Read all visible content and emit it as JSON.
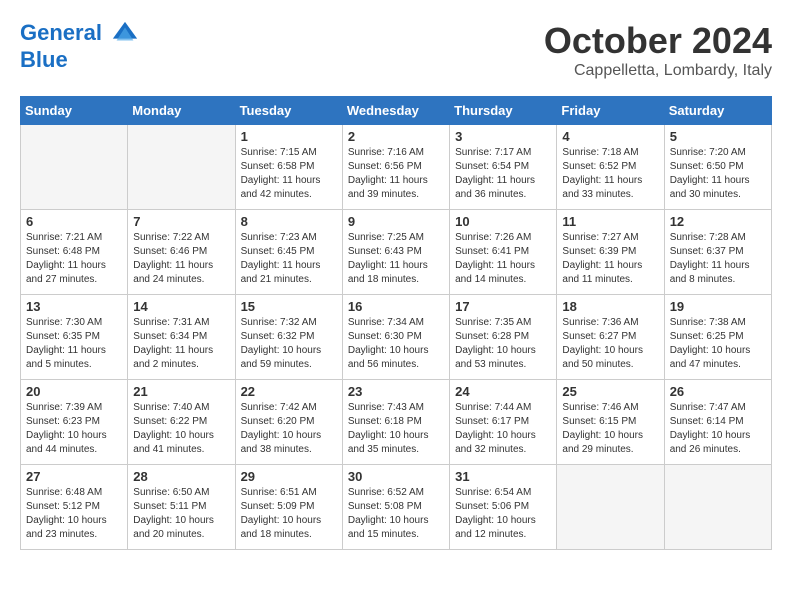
{
  "logo": {
    "line1": "General",
    "line2": "Blue"
  },
  "header": {
    "month": "October 2024",
    "location": "Cappelletta, Lombardy, Italy"
  },
  "weekdays": [
    "Sunday",
    "Monday",
    "Tuesday",
    "Wednesday",
    "Thursday",
    "Friday",
    "Saturday"
  ],
  "weeks": [
    [
      {
        "day": "",
        "info": "",
        "empty": true
      },
      {
        "day": "",
        "info": "",
        "empty": true
      },
      {
        "day": "1",
        "info": "Sunrise: 7:15 AM\nSunset: 6:58 PM\nDaylight: 11 hours\nand 42 minutes."
      },
      {
        "day": "2",
        "info": "Sunrise: 7:16 AM\nSunset: 6:56 PM\nDaylight: 11 hours\nand 39 minutes."
      },
      {
        "day": "3",
        "info": "Sunrise: 7:17 AM\nSunset: 6:54 PM\nDaylight: 11 hours\nand 36 minutes."
      },
      {
        "day": "4",
        "info": "Sunrise: 7:18 AM\nSunset: 6:52 PM\nDaylight: 11 hours\nand 33 minutes."
      },
      {
        "day": "5",
        "info": "Sunrise: 7:20 AM\nSunset: 6:50 PM\nDaylight: 11 hours\nand 30 minutes."
      }
    ],
    [
      {
        "day": "6",
        "info": "Sunrise: 7:21 AM\nSunset: 6:48 PM\nDaylight: 11 hours\nand 27 minutes."
      },
      {
        "day": "7",
        "info": "Sunrise: 7:22 AM\nSunset: 6:46 PM\nDaylight: 11 hours\nand 24 minutes."
      },
      {
        "day": "8",
        "info": "Sunrise: 7:23 AM\nSunset: 6:45 PM\nDaylight: 11 hours\nand 21 minutes."
      },
      {
        "day": "9",
        "info": "Sunrise: 7:25 AM\nSunset: 6:43 PM\nDaylight: 11 hours\nand 18 minutes."
      },
      {
        "day": "10",
        "info": "Sunrise: 7:26 AM\nSunset: 6:41 PM\nDaylight: 11 hours\nand 14 minutes."
      },
      {
        "day": "11",
        "info": "Sunrise: 7:27 AM\nSunset: 6:39 PM\nDaylight: 11 hours\nand 11 minutes."
      },
      {
        "day": "12",
        "info": "Sunrise: 7:28 AM\nSunset: 6:37 PM\nDaylight: 11 hours\nand 8 minutes."
      }
    ],
    [
      {
        "day": "13",
        "info": "Sunrise: 7:30 AM\nSunset: 6:35 PM\nDaylight: 11 hours\nand 5 minutes."
      },
      {
        "day": "14",
        "info": "Sunrise: 7:31 AM\nSunset: 6:34 PM\nDaylight: 11 hours\nand 2 minutes."
      },
      {
        "day": "15",
        "info": "Sunrise: 7:32 AM\nSunset: 6:32 PM\nDaylight: 10 hours\nand 59 minutes."
      },
      {
        "day": "16",
        "info": "Sunrise: 7:34 AM\nSunset: 6:30 PM\nDaylight: 10 hours\nand 56 minutes."
      },
      {
        "day": "17",
        "info": "Sunrise: 7:35 AM\nSunset: 6:28 PM\nDaylight: 10 hours\nand 53 minutes."
      },
      {
        "day": "18",
        "info": "Sunrise: 7:36 AM\nSunset: 6:27 PM\nDaylight: 10 hours\nand 50 minutes."
      },
      {
        "day": "19",
        "info": "Sunrise: 7:38 AM\nSunset: 6:25 PM\nDaylight: 10 hours\nand 47 minutes."
      }
    ],
    [
      {
        "day": "20",
        "info": "Sunrise: 7:39 AM\nSunset: 6:23 PM\nDaylight: 10 hours\nand 44 minutes."
      },
      {
        "day": "21",
        "info": "Sunrise: 7:40 AM\nSunset: 6:22 PM\nDaylight: 10 hours\nand 41 minutes."
      },
      {
        "day": "22",
        "info": "Sunrise: 7:42 AM\nSunset: 6:20 PM\nDaylight: 10 hours\nand 38 minutes."
      },
      {
        "day": "23",
        "info": "Sunrise: 7:43 AM\nSunset: 6:18 PM\nDaylight: 10 hours\nand 35 minutes."
      },
      {
        "day": "24",
        "info": "Sunrise: 7:44 AM\nSunset: 6:17 PM\nDaylight: 10 hours\nand 32 minutes."
      },
      {
        "day": "25",
        "info": "Sunrise: 7:46 AM\nSunset: 6:15 PM\nDaylight: 10 hours\nand 29 minutes."
      },
      {
        "day": "26",
        "info": "Sunrise: 7:47 AM\nSunset: 6:14 PM\nDaylight: 10 hours\nand 26 minutes."
      }
    ],
    [
      {
        "day": "27",
        "info": "Sunrise: 6:48 AM\nSunset: 5:12 PM\nDaylight: 10 hours\nand 23 minutes."
      },
      {
        "day": "28",
        "info": "Sunrise: 6:50 AM\nSunset: 5:11 PM\nDaylight: 10 hours\nand 20 minutes."
      },
      {
        "day": "29",
        "info": "Sunrise: 6:51 AM\nSunset: 5:09 PM\nDaylight: 10 hours\nand 18 minutes."
      },
      {
        "day": "30",
        "info": "Sunrise: 6:52 AM\nSunset: 5:08 PM\nDaylight: 10 hours\nand 15 minutes."
      },
      {
        "day": "31",
        "info": "Sunrise: 6:54 AM\nSunset: 5:06 PM\nDaylight: 10 hours\nand 12 minutes."
      },
      {
        "day": "",
        "info": "",
        "empty": true
      },
      {
        "day": "",
        "info": "",
        "empty": true
      }
    ]
  ]
}
